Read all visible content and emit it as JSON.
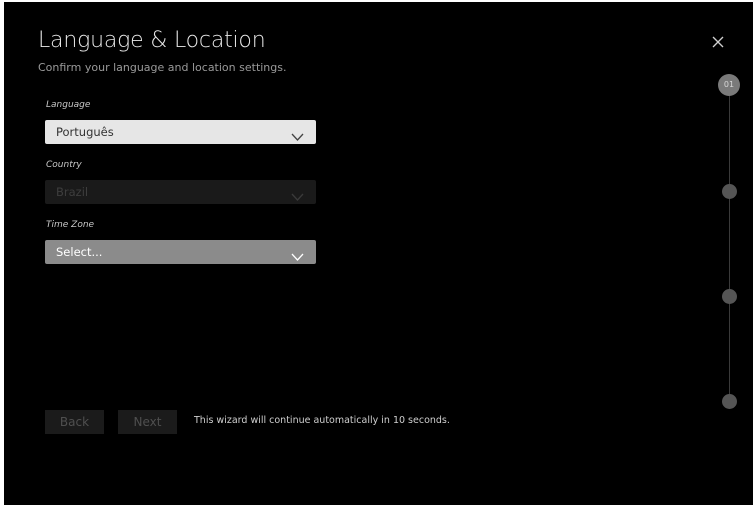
{
  "header": {
    "title": "Language & Location",
    "subtitle": "Confirm your language and location settings."
  },
  "fields": {
    "language": {
      "label": "Language",
      "value": "Português"
    },
    "country": {
      "label": "Country",
      "value": "Brazil"
    },
    "time_zone": {
      "label": "Time Zone",
      "value": "Select..."
    }
  },
  "steps": {
    "current": "01",
    "total": 4
  },
  "footer": {
    "back_label": "Back",
    "next_label": "Next",
    "auto_message": "This wizard will continue automatically in 10 seconds."
  },
  "icons": {
    "close": "close-icon",
    "dropdown": "chevron-down-icon"
  },
  "colors": {
    "background": "#000000",
    "dropdown_active": "#e6e6e6",
    "dropdown_disabled": "#1a1a1a",
    "dropdown_focused": "#8b8b8b",
    "step_active": "#7a7a7a"
  }
}
